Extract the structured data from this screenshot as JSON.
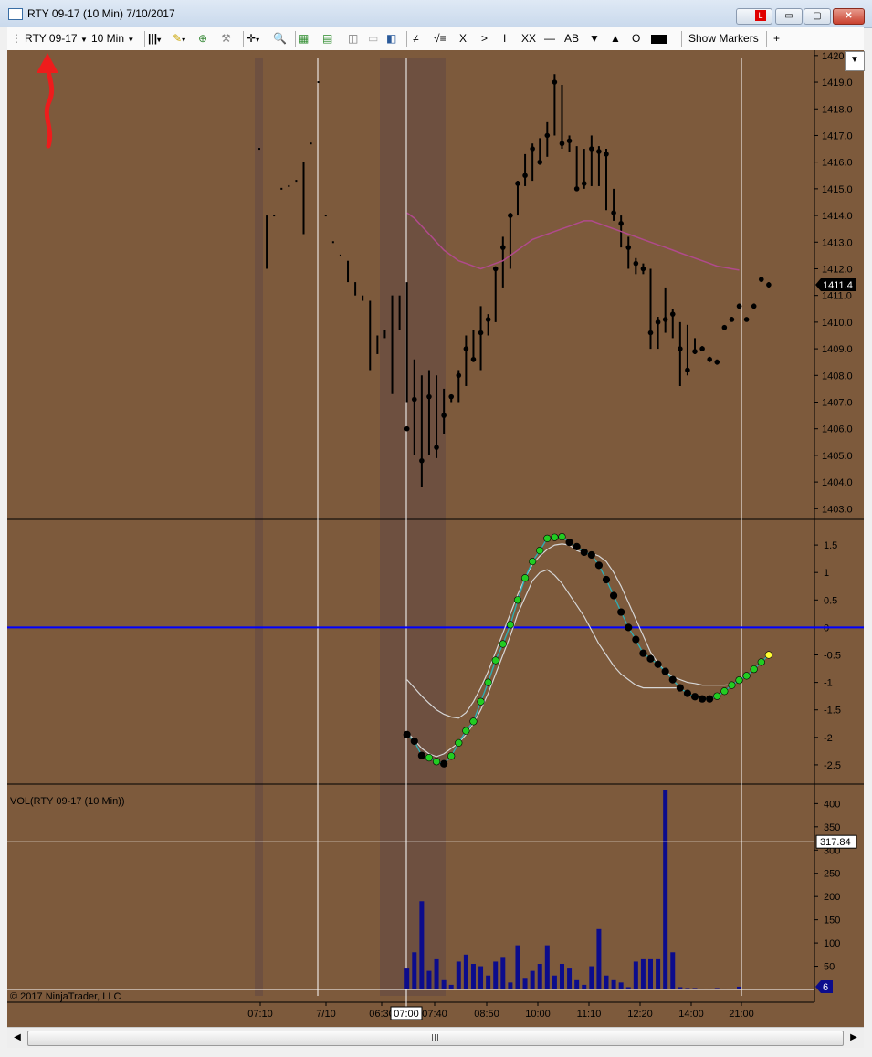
{
  "window": {
    "title": "RTY 09-17 (10 Min)  7/10/2017",
    "link_button_label": "L",
    "minimize": "▭",
    "maximize": "▢",
    "close": "✕"
  },
  "toolbar": {
    "instrument": "RTY 09-17",
    "interval": "10 Min",
    "buttons": [
      "≠",
      "√≡",
      "X",
      ">",
      "I",
      "XX",
      "—",
      "AB",
      "▼",
      "▲",
      "O"
    ],
    "show_markers": "Show Markers",
    "add": "+"
  },
  "price_panel": {
    "y_labels": [
      "1420",
      "1419.0",
      "1418.0",
      "1417.0",
      "1416.0",
      "1415.0",
      "1414.0",
      "1413.0",
      "1412.0",
      "1411.0",
      "1410.0",
      "1409.0",
      "1408.0",
      "1407.0",
      "1406.0",
      "1405.0",
      "1404.0",
      "1403.0"
    ],
    "last_price": "1411.4"
  },
  "oscillator_panel": {
    "y_labels": [
      "1.5",
      "1",
      "0.5",
      "0",
      "-0.5",
      "-1",
      "-1.5",
      "-2",
      "-2.5"
    ]
  },
  "volume_panel": {
    "label": "VOL(RTY 09-17 (10 Min))",
    "y_labels": [
      "400",
      "350",
      "300",
      "250",
      "200",
      "150",
      "100",
      "50"
    ],
    "crosshair_value": "317.84",
    "last_volume": "6",
    "copyright": "© 2017 NinjaTrader, LLC"
  },
  "time_axis": {
    "labels": [
      "07:10",
      "7/10",
      "06:30",
      "07:40",
      "08:50",
      "10:00",
      "11:10",
      "12:20",
      "14:00",
      "21:00"
    ],
    "crosshair_time": "07:00"
  },
  "colors": {
    "background": "#7d5a3c",
    "session_shade": "#6e5040",
    "zero_line": "#0000ff",
    "ma_line": "#b04a8c",
    "volume_bar": "#0c0c8c",
    "osc_up": "#22cc22",
    "osc_down": "#000000",
    "osc_last": "#ffff33"
  },
  "chart_data": [
    {
      "type": "bar",
      "series_kind": "ohlc-price",
      "title": "RTY 09-17 (10 Min)",
      "ylim": [
        1402.6,
        1420.2
      ],
      "bars": [
        {
          "h": 1416.5,
          "l": 1416.5,
          "c": 1416.5
        },
        {
          "h": 1414.0,
          "l": 1412.0,
          "c": 1414.0
        },
        {
          "h": 1414.0,
          "l": 1414.0,
          "c": 1414.0
        },
        {
          "h": 1415.0,
          "l": 1415.0,
          "c": 1415.0
        },
        {
          "h": 1415.1,
          "l": 1415.1,
          "c": 1415.1
        },
        {
          "h": 1415.3,
          "l": 1415.3,
          "c": 1415.3
        },
        {
          "h": 1416.0,
          "l": 1413.3,
          "c": 1416.0
        },
        {
          "h": 1416.7,
          "l": 1416.7,
          "c": 1416.7
        },
        {
          "h": 1419.0,
          "l": 1419.0,
          "c": 1419.0
        },
        {
          "h": 1414.0,
          "l": 1414.0,
          "c": 1414.0
        },
        {
          "h": 1413.0,
          "l": 1413.0,
          "c": 1413.0
        },
        {
          "h": 1412.5,
          "l": 1412.5,
          "c": 1412.5
        },
        {
          "h": 1412.3,
          "l": 1411.5,
          "c": 1411.8
        },
        {
          "h": 1411.5,
          "l": 1411.0,
          "c": 1411.0
        },
        {
          "h": 1411.0,
          "l": 1410.8,
          "c": 1410.8
        },
        {
          "h": 1410.8,
          "l": 1408.2,
          "c": 1409.8
        },
        {
          "h": 1409.5,
          "l": 1408.8,
          "c": 1409.0
        },
        {
          "h": 1409.7,
          "l": 1409.4,
          "c": 1409.6
        },
        {
          "h": 1411.0,
          "l": 1407.3,
          "c": 1410.0
        },
        {
          "h": 1411.0,
          "l": 1409.7,
          "c": 1410.0
        },
        {
          "h": 1411.5,
          "l": 1407.0,
          "c": 1406.0
        },
        {
          "h": 1408.6,
          "l": 1405.0,
          "c": 1407.1
        },
        {
          "h": 1408.0,
          "l": 1403.8,
          "c": 1404.8
        },
        {
          "h": 1408.2,
          "l": 1405.0,
          "c": 1407.2
        },
        {
          "h": 1408.0,
          "l": 1404.9,
          "c": 1405.3
        },
        {
          "h": 1407.5,
          "l": 1405.8,
          "c": 1406.5
        },
        {
          "h": 1407.2,
          "l": 1407.0,
          "c": 1407.2
        },
        {
          "h": 1408.2,
          "l": 1407.0,
          "c": 1408.0
        },
        {
          "h": 1409.5,
          "l": 1407.6,
          "c": 1409.0
        },
        {
          "h": 1409.7,
          "l": 1408.5,
          "c": 1408.6
        },
        {
          "h": 1410.6,
          "l": 1408.2,
          "c": 1409.6
        },
        {
          "h": 1410.3,
          "l": 1409.5,
          "c": 1410.1
        },
        {
          "h": 1412.0,
          "l": 1410.0,
          "c": 1412.0
        },
        {
          "h": 1413.2,
          "l": 1411.3,
          "c": 1412.8
        },
        {
          "h": 1414.1,
          "l": 1412.0,
          "c": 1414.0
        },
        {
          "h": 1415.3,
          "l": 1414.0,
          "c": 1415.2
        },
        {
          "h": 1416.3,
          "l": 1415.1,
          "c": 1415.5
        },
        {
          "h": 1416.7,
          "l": 1415.3,
          "c": 1416.5
        },
        {
          "h": 1416.9,
          "l": 1415.9,
          "c": 1416.0
        },
        {
          "h": 1417.5,
          "l": 1416.2,
          "c": 1417.0
        },
        {
          "h": 1419.3,
          "l": 1417.0,
          "c": 1419.0
        },
        {
          "h": 1418.9,
          "l": 1416.5,
          "c": 1416.7
        },
        {
          "h": 1417.0,
          "l": 1416.4,
          "c": 1416.8
        },
        {
          "h": 1416.6,
          "l": 1415.0,
          "c": 1415.0
        },
        {
          "h": 1416.5,
          "l": 1415.0,
          "c": 1415.2
        },
        {
          "h": 1417.0,
          "l": 1415.1,
          "c": 1416.5
        },
        {
          "h": 1416.6,
          "l": 1415.1,
          "c": 1416.4
        },
        {
          "h": 1416.5,
          "l": 1414.2,
          "c": 1416.3
        },
        {
          "h": 1415.0,
          "l": 1413.8,
          "c": 1414.1
        },
        {
          "h": 1414.0,
          "l": 1412.8,
          "c": 1413.7
        },
        {
          "h": 1413.2,
          "l": 1412.0,
          "c": 1412.8
        },
        {
          "h": 1412.4,
          "l": 1411.8,
          "c": 1412.2
        },
        {
          "h": 1412.2,
          "l": 1411.8,
          "c": 1412.0
        },
        {
          "h": 1412.0,
          "l": 1409.0,
          "c": 1409.6
        },
        {
          "h": 1410.2,
          "l": 1409.0,
          "c": 1410.0
        },
        {
          "h": 1411.3,
          "l": 1409.6,
          "c": 1410.1
        },
        {
          "h": 1410.5,
          "l": 1409.4,
          "c": 1410.3
        },
        {
          "h": 1410.0,
          "l": 1407.6,
          "c": 1409.0
        },
        {
          "h": 1409.9,
          "l": 1408.0,
          "c": 1408.2
        },
        {
          "h": 1409.4,
          "l": 1408.8,
          "c": 1408.9
        },
        {
          "h": 1409.1,
          "l": 1408.9,
          "c": 1409.0
        },
        {
          "h": 1408.7,
          "l": 1408.5,
          "c": 1408.6
        },
        {
          "h": 1408.6,
          "l": 1408.4,
          "c": 1408.5
        },
        {
          "h": 1409.8,
          "l": 1409.8,
          "c": 1409.8
        },
        {
          "h": 1410.2,
          "l": 1410.1,
          "c": 1410.1
        },
        {
          "h": 1410.7,
          "l": 1410.5,
          "c": 1410.6
        },
        {
          "h": 1410.1,
          "l": 1410.1,
          "c": 1410.1
        },
        {
          "h": 1410.7,
          "l": 1410.5,
          "c": 1410.6
        },
        {
          "h": 1411.7,
          "l": 1411.6,
          "c": 1411.6
        },
        {
          "h": 1411.5,
          "l": 1411.3,
          "c": 1411.4
        }
      ]
    },
    {
      "type": "line",
      "series_kind": "moving-average",
      "start_bar": 20,
      "values": [
        1414.1,
        1413.9,
        1413.6,
        1413.3,
        1413.0,
        1412.7,
        1412.5,
        1412.3,
        1412.2,
        1412.1,
        1412.0,
        1412.1,
        1412.2,
        1412.3,
        1412.5,
        1412.7,
        1412.9,
        1413.1,
        1413.2,
        1413.3,
        1413.4,
        1413.5,
        1413.6,
        1413.7,
        1413.8,
        1413.8,
        1413.7,
        1413.6,
        1413.5,
        1413.4,
        1413.3,
        1413.2,
        1413.1,
        1413.0,
        1412.9,
        1412.8,
        1412.7,
        1412.6,
        1412.5,
        1412.4,
        1412.3,
        1412.2,
        1412.1,
        1412.05,
        1412.0,
        1411.95
      ]
    },
    {
      "type": "line",
      "series_kind": "oscillator",
      "ylim": [
        -2.85,
        1.95
      ],
      "zero_line": 0,
      "start_bar": 20,
      "values": [
        -1.95,
        -2.07,
        -2.33,
        -2.37,
        -2.44,
        -2.48,
        -2.34,
        -2.1,
        -1.88,
        -1.71,
        -1.35,
        -1.0,
        -0.6,
        -0.3,
        0.05,
        0.5,
        0.9,
        1.2,
        1.4,
        1.62,
        1.64,
        1.65,
        1.55,
        1.47,
        1.37,
        1.32,
        1.13,
        0.87,
        0.58,
        0.28,
        0.0,
        -0.22,
        -0.47,
        -0.57,
        -0.67,
        -0.8,
        -0.95,
        -1.1,
        -1.2,
        -1.26,
        -1.3,
        -1.3,
        -1.25,
        -1.16,
        -1.05,
        -0.96,
        -0.88,
        -0.76,
        -0.63,
        -0.5
      ],
      "colors": [
        "down",
        "down",
        "down",
        "up",
        "up",
        "down",
        "up",
        "up",
        "up",
        "up",
        "up",
        "up",
        "up",
        "up",
        "up",
        "up",
        "up",
        "up",
        "up",
        "up",
        "up",
        "up",
        "down",
        "down",
        "down",
        "down",
        "down",
        "down",
        "down",
        "down",
        "down",
        "down",
        "down",
        "down",
        "down",
        "down",
        "down",
        "down",
        "down",
        "down",
        "down",
        "down",
        "up",
        "up",
        "up",
        "up",
        "up",
        "up",
        "up",
        "last"
      ],
      "band_upper": {
        "start_bar": 20,
        "values": [
          -0.95,
          -1.1,
          -1.25,
          -1.38,
          -1.5,
          -1.58,
          -1.63,
          -1.65,
          -1.55,
          -1.35,
          -1.1,
          -0.8,
          -0.45,
          -0.1,
          0.25,
          0.6,
          0.9,
          1.15,
          1.3,
          1.42,
          1.5,
          1.52,
          1.5,
          1.4,
          1.35,
          1.35,
          1.3,
          1.2,
          1.0,
          0.75,
          0.45,
          0.15,
          -0.15,
          -0.45,
          -0.65,
          -0.8,
          -0.9,
          -0.95,
          -1.0,
          -1.02,
          -1.05,
          -1.05,
          -1.05,
          -1.05,
          -1.04
        ]
      },
      "band_lower": {
        "start_bar": 20,
        "values": [
          -1.9,
          -2.05,
          -2.2,
          -2.3,
          -2.35,
          -2.3,
          -2.2,
          -2.1,
          -1.95,
          -1.75,
          -1.5,
          -1.2,
          -0.85,
          -0.5,
          -0.15,
          0.25,
          0.55,
          0.85,
          1.0,
          1.05,
          0.95,
          0.8,
          0.6,
          0.4,
          0.2,
          -0.05,
          -0.3,
          -0.5,
          -0.7,
          -0.85,
          -0.95,
          -1.05,
          -1.1,
          -1.1,
          -1.1,
          -1.1,
          -1.1,
          -1.1
        ]
      }
    },
    {
      "type": "bar",
      "series_kind": "volume",
      "ylim": [
        0,
        440
      ],
      "start_bar": 20,
      "values": [
        45,
        80,
        190,
        40,
        65,
        20,
        10,
        60,
        75,
        55,
        50,
        30,
        60,
        70,
        15,
        95,
        25,
        40,
        55,
        95,
        30,
        55,
        45,
        20,
        10,
        50,
        130,
        30,
        20,
        15,
        5,
        60,
        65,
        65,
        65,
        430,
        80,
        5,
        3,
        3,
        2,
        2,
        3,
        2,
        2,
        6
      ]
    }
  ]
}
